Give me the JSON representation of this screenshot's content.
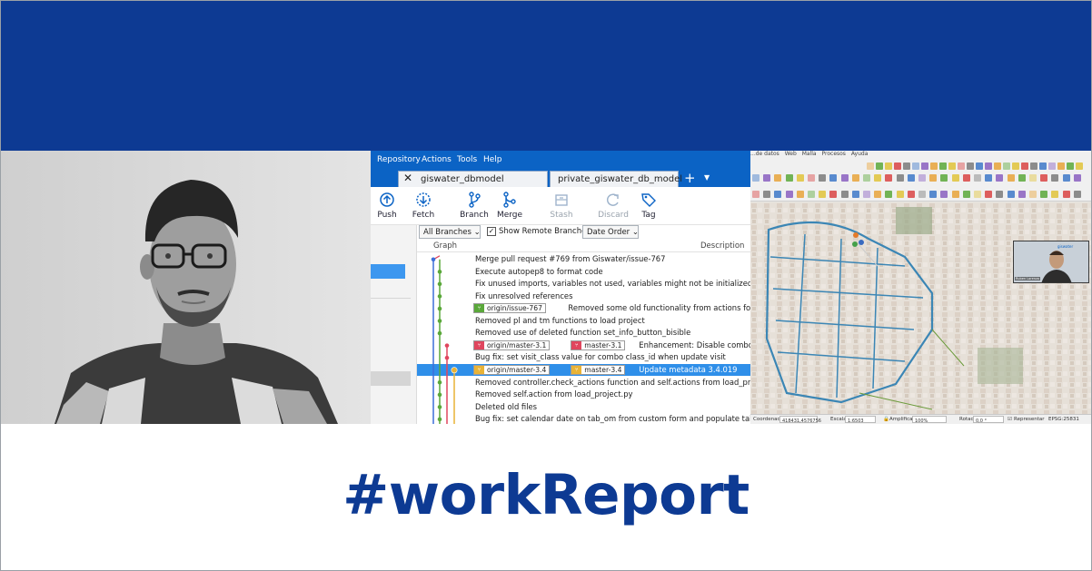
{
  "colors": {
    "brand_blue": "#0d3a93",
    "sourcetree_blue": "#0b63c5",
    "selected_row": "#2f8fe9"
  },
  "headline": "#workReport",
  "sourcetree": {
    "menu": [
      "Repository",
      "Actions",
      "Tools",
      "Help"
    ],
    "tabs": [
      "giswater_dbmodel",
      "private_giswater_db_model"
    ],
    "tab_close_icon": "close-icon",
    "tab_add_icon": "plus-icon",
    "toolbar": [
      {
        "label": "Push",
        "icon": "push-icon",
        "enabled": true
      },
      {
        "label": "Fetch",
        "icon": "fetch-icon",
        "enabled": true
      },
      {
        "label": "Branch",
        "icon": "branch-icon",
        "enabled": true
      },
      {
        "label": "Merge",
        "icon": "merge-icon",
        "enabled": true
      },
      {
        "label": "Stash",
        "icon": "stash-icon",
        "enabled": false
      },
      {
        "label": "Discard",
        "icon": "discard-icon",
        "enabled": false
      },
      {
        "label": "Tag",
        "icon": "tag-icon",
        "enabled": true
      }
    ],
    "filters": {
      "branches": "All Branches",
      "show_remote": "Show Remote Branches",
      "show_remote_checked": true,
      "order": "Date Order"
    },
    "columns": {
      "graph": "Graph",
      "description": "Description"
    },
    "commits": [
      {
        "badges": [],
        "text": "Merge pull request #769 from Giswater/issue-767"
      },
      {
        "badges": [],
        "text": "Execute autopep8 to format code"
      },
      {
        "badges": [],
        "text": "Fix unused imports, variables not used, variables might not be initialized"
      },
      {
        "badges": [],
        "text": "Fix unresolved references"
      },
      {
        "badges": [
          {
            "label": "origin/issue-767",
            "color": "#5aa83a"
          }
        ],
        "text": "Removed some old functionality from actions folder"
      },
      {
        "badges": [],
        "text": "Removed pl and tm functions to load project"
      },
      {
        "badges": [],
        "text": "Removed use of deleted function set_info_button_bisible"
      },
      {
        "badges": [
          {
            "label": "origin/master-3.1",
            "color": "#e0465e"
          },
          {
            "label": "master-3.1",
            "color": "#e0465e"
          }
        ],
        "text": "Enhancement: Disable combo class_id"
      },
      {
        "badges": [],
        "text": "Bug fix: set visit_class value for combo class_id when update visit"
      },
      {
        "badges": [
          {
            "label": "origin/master-3.4",
            "color": "#e9b336"
          },
          {
            "label": "master-3.4",
            "color": "#e9b336"
          }
        ],
        "text": "Update metadata 3.4.019",
        "selected": true
      },
      {
        "badges": [],
        "text": "Removed controller.check_actions function and self.actions from load_project.py"
      },
      {
        "badges": [],
        "text": "Removed self.action from load_project.py"
      },
      {
        "badges": [],
        "text": "Deleted old files"
      },
      {
        "badges": [],
        "text": "Bug fix: set calendar date on tab_om from custom form and populate table with a"
      }
    ]
  },
  "qgis": {
    "menu": [
      "...de datos",
      "Web",
      "Malla",
      "Procesos",
      "Ayuda"
    ],
    "status": {
      "coord_label": "Coordenada",
      "coord_value": "418431,4576756",
      "scale_label": "Escala",
      "scale_value": "1:6503",
      "magnifier_label": "Amplificador",
      "magnifier_value": "100%",
      "rotation_label": "Rotación",
      "rotation_value": "0,0 °",
      "render_label": "Representar",
      "crs": "EPSG:25831"
    },
    "webcam_logo": "giswater",
    "webcam_name": "Ruben Lorenzo"
  }
}
